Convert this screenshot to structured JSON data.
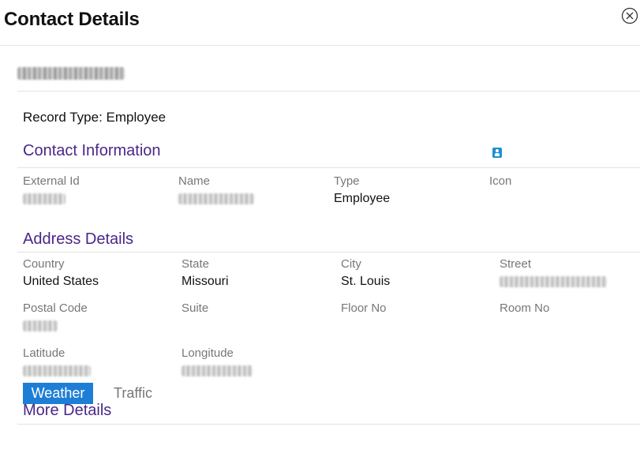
{
  "modal": {
    "title": "Contact Details",
    "close_icon": "close-circle-icon"
  },
  "contact": {
    "record_type": "Record Type: Employee"
  },
  "sections": {
    "contact_information": {
      "title": "Contact Information",
      "fields": {
        "external_id": {
          "label": "External Id"
        },
        "name": {
          "label": "Name"
        },
        "type": {
          "label": "Type",
          "value": "Employee"
        },
        "icon": {
          "label": "Icon",
          "icon": "employee-badge-icon"
        }
      }
    },
    "address_details": {
      "title": "Address Details",
      "fields": {
        "country": {
          "label": "Country",
          "value": "United States"
        },
        "state": {
          "label": "State",
          "value": "Missouri"
        },
        "city": {
          "label": "City",
          "value": "St. Louis"
        },
        "street": {
          "label": "Street"
        },
        "postal_code": {
          "label": "Postal Code"
        },
        "suite": {
          "label": "Suite"
        },
        "floor_no": {
          "label": "Floor No"
        },
        "room_no": {
          "label": "Room No"
        },
        "latitude": {
          "label": "Latitude"
        },
        "longitude": {
          "label": "Longitude"
        }
      }
    },
    "more_details": {
      "title": "More Details",
      "tabs": [
        {
          "label": "Weather",
          "active": true
        },
        {
          "label": "Traffic",
          "active": false
        }
      ]
    }
  },
  "colors": {
    "section_title": "#4a2787",
    "tab_active_bg": "#1e7ed6",
    "label": "#777777"
  }
}
